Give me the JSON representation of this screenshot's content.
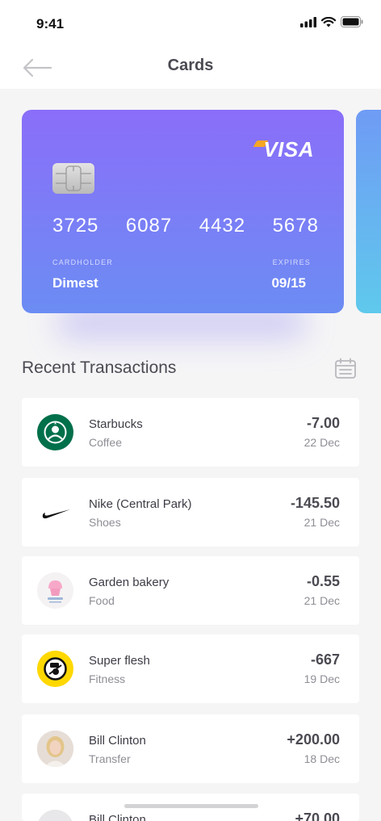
{
  "status": {
    "time": "9:41"
  },
  "header": {
    "title": "Cards"
  },
  "card": {
    "brand": "VISA",
    "number_groups": [
      "3725",
      "6087",
      "4432",
      "5678"
    ],
    "cardholder_label": "CARDHOLDER",
    "cardholder": "Dimest",
    "expires_label": "EXPIRES",
    "expires": "09/15"
  },
  "transactions": {
    "title": "Recent Transactions",
    "items": [
      {
        "name": "Starbucks",
        "category": "Coffee",
        "amount": "-7.00",
        "date": "22 Dec"
      },
      {
        "name": "Nike (Central Park)",
        "category": "Shoes",
        "amount": "-145.50",
        "date": "21 Dec"
      },
      {
        "name": "Garden bakery",
        "category": "Food",
        "amount": "-0.55",
        "date": "21 Dec"
      },
      {
        "name": "Super flesh",
        "category": "Fitness",
        "amount": "-667",
        "date": "19 Dec"
      },
      {
        "name": "Bill Clinton",
        "category": "Transfer",
        "amount": "+200.00",
        "date": "18 Dec"
      },
      {
        "name": "Bill Clinton",
        "category": "",
        "amount": "+70.00",
        "date": ""
      }
    ]
  },
  "icons": {
    "back": "arrow-left-icon",
    "calendar": "calendar-icon",
    "signal": "signal-icon",
    "wifi": "wifi-icon",
    "battery": "battery-icon"
  },
  "colors": {
    "card_gradient_top": "#8a6ef9",
    "card_gradient_bottom": "#6b8cf3",
    "visa_accent": "#f5a623"
  }
}
